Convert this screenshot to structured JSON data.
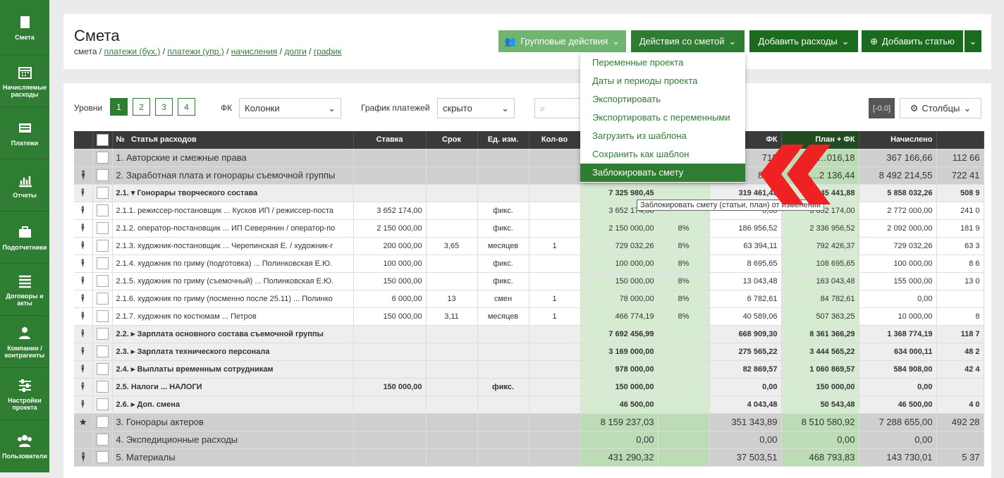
{
  "sidebar": [
    {
      "l": "Смета",
      "i": "book-icon"
    },
    {
      "l": "Начисляемые расходы",
      "i": "calendar-icon"
    },
    {
      "l": "Платежи",
      "i": "payments-icon"
    },
    {
      "l": "Отчеты",
      "i": "chart-icon"
    },
    {
      "l": "Подотчетники",
      "i": "briefcase-icon"
    },
    {
      "l": "Договоры и акты",
      "i": "list-icon"
    },
    {
      "l": "Компании / контрагенты",
      "i": "person-icon"
    },
    {
      "l": "Настройки проекта",
      "i": "sliders-icon"
    },
    {
      "l": "Пользователи",
      "i": "users-icon"
    }
  ],
  "header": {
    "title": "Смета",
    "crumbs": [
      "смета",
      "платежи (бух.)",
      "платежи (упр.)",
      "начисления",
      "долги",
      "график"
    ],
    "group": "Групповые действия",
    "actions": "Действия со сметой",
    "add_exp": "Добавить расходы",
    "add_item": "Добавить статью"
  },
  "menu": [
    "Переменные проекта",
    "Даты и периоды проекта",
    "Экспортировать",
    "Экспортировать с переменными",
    "Загрузить из шаблона",
    "Сохранить как шаблон",
    "Заблокировать смету"
  ],
  "tooltip": "Заблокировать смету (статьи, план) от изменений",
  "toolbar": {
    "levels_label": "Уровни",
    "levels": [
      "1",
      "2",
      "3",
      "4"
    ],
    "fk_label": "ФК",
    "fk": "Колонки",
    "sched_label": "График платежей",
    "sched": "скрыто",
    "badge": "[-0.0]",
    "cols": "Столбцы"
  },
  "cols": [
    "№",
    "Статья расходов",
    "Ставка",
    "Срок",
    "Ед. изм.",
    "Кол-во",
    "",
    "",
    "ФК",
    "План + ФК",
    "Начислено",
    ""
  ],
  "rows": [
    [
      "g",
      "",
      "1. Авторские и смежные права",
      "",
      "",
      "",
      "",
      "",
      "",
      "718",
      "2 …016,18",
      "367 166,66",
      "112 66"
    ],
    [
      "g",
      "p",
      "2. Заработная плата и гонорары съемочной группы",
      "",
      "",
      "",
      "",
      "",
      "",
      "84…",
      "2 …2 136,44",
      "8 492 214,55",
      "722 41"
    ],
    [
      "s",
      "p",
      "2.1. ▾ Гонорары творческого состава",
      "",
      "",
      "",
      "",
      "7 325 980,45",
      "",
      "319 461,43",
      "7 645 441,88",
      "5 858 032,26",
      "508 9"
    ],
    [
      "r",
      "p",
      "2.1.1.   режиссер-постановщик ... Кусков ИП / режиссер-поста",
      "3 652 174,00",
      "",
      "фикс.",
      "",
      "3 652 174,00",
      "",
      "0,00",
      "3 652 174,00",
      "2 772 000,00",
      "241 0"
    ],
    [
      "r",
      "p",
      "2.1.2.   оператор-постановщик ... ИП Северянин / оператор-по",
      "2 150 000,00",
      "",
      "фикс.",
      "",
      "2 150 000,00",
      "8%",
      "186 956,52",
      "2 336 956,52",
      "2 092 000,00",
      "181 9"
    ],
    [
      "r",
      "p",
      "2.1.3.   художник-постановщик ... Черепинская Е. / художник-г",
      "200 000,00",
      "3,65",
      "месяцев",
      "1",
      "729 032,26",
      "8%",
      "63 394,11",
      "792 426,37",
      "729 032,26",
      "63 3"
    ],
    [
      "r",
      "p",
      "2.1.4.   художник по гриму (подготовка) ... Полинковская Е.Ю.",
      "100 000,00",
      "",
      "фикс.",
      "",
      "100 000,00",
      "8%",
      "8 695,65",
      "108 695,65",
      "100 000,00",
      "8 6"
    ],
    [
      "r",
      "p",
      "2.1.5.   художник по гриму (съемочный) ... Полинковская Е.Ю.",
      "150 000,00",
      "",
      "фикс.",
      "",
      "150 000,00",
      "8%",
      "13 043,48",
      "163 043,48",
      "155 000,00",
      "13 0"
    ],
    [
      "r",
      "p",
      "2.1.6.   художник по гриму (посменно после 25.11) ... Полинко",
      "6 000,00",
      "13",
      "смен",
      "1",
      "78 000,00",
      "8%",
      "6 782,61",
      "84 782,61",
      "0,00",
      ""
    ],
    [
      "r",
      "p",
      "2.1.7.   художник по костюмам ... Петров",
      "150 000,00",
      "3,11",
      "месяцев",
      "1",
      "466 774,19",
      "8%",
      "40 589,06",
      "507 363,25",
      "10 000,00",
      "8"
    ],
    [
      "s",
      "p",
      "2.2. ▸ Зарплата основного состава съемочной группы",
      "",
      "",
      "",
      "",
      "7 692 456,99",
      "",
      "668 909,30",
      "8 361 366,29",
      "1 368 774,19",
      "118 7"
    ],
    [
      "s",
      "p",
      "2.3. ▸ Зарплата технического персонала",
      "",
      "",
      "",
      "",
      "3 169 000,00",
      "",
      "275 565,22",
      "3 444 565,22",
      "634 000,11",
      "48 2"
    ],
    [
      "s",
      "p",
      "2.4. ▸ Выплаты временным сотрудникам",
      "",
      "",
      "",
      "",
      "978 000,00",
      "",
      "82 869,57",
      "1 060 869,57",
      "584 908,00",
      "42 4"
    ],
    [
      "s",
      "p",
      "2.5.   Налоги ... НАЛОГИ",
      "150 000,00",
      "",
      "фикс.",
      "",
      "150 000,00",
      "",
      "0,00",
      "150 000,00",
      "0,00",
      ""
    ],
    [
      "s",
      "p",
      "2.6. ▸ Доп. смена",
      "",
      "",
      "",
      "",
      "46 500,00",
      "",
      "4 043,48",
      "50 543,48",
      "46 500,00",
      "4 0"
    ],
    [
      "g",
      "s",
      "3. Гонорары актеров",
      "",
      "",
      "",
      "",
      "8 159 237,03",
      "",
      "351 343,89",
      "8 510 580,92",
      "7 288 655,00",
      "492 28"
    ],
    [
      "g",
      "",
      "4. Экспедиционные расходы",
      "",
      "",
      "",
      "",
      "0,00",
      "",
      "0,00",
      "0,00",
      "0,00",
      ""
    ],
    [
      "g",
      "p",
      "5. Материалы",
      "",
      "",
      "",
      "",
      "431 290,32",
      "",
      "37 503,51",
      "468 793,83",
      "143 730,01",
      "5 37"
    ]
  ]
}
